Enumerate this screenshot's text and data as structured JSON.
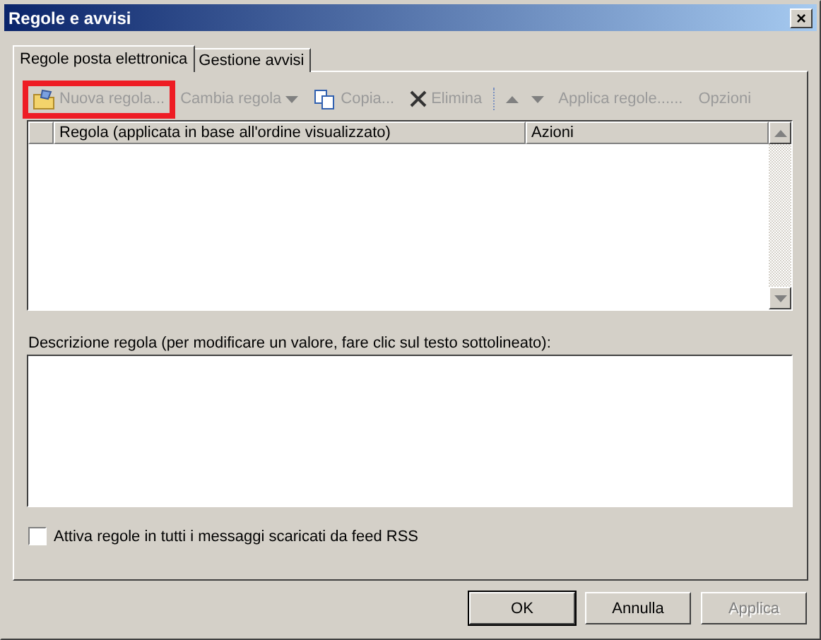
{
  "window": {
    "title": "Regole e avvisi",
    "close": "×"
  },
  "tabs": [
    {
      "label": "Regole posta elettronica",
      "selected": true
    },
    {
      "label": "Gestione avvisi",
      "selected": false
    }
  ],
  "toolbar": [
    {
      "kind": "new",
      "label": "Nuova regola...",
      "disabled": true,
      "highlighted": true
    },
    {
      "kind": "menu",
      "label": "Cambia regola",
      "disabled": true,
      "highlighted": false
    },
    {
      "kind": "copy",
      "label": "Copia...",
      "disabled": true,
      "highlighted": false
    },
    {
      "kind": "delete",
      "label": "Elimina",
      "disabled": true,
      "highlighted": false
    },
    {
      "kind": "separator"
    },
    {
      "kind": "up",
      "disabled": true
    },
    {
      "kind": "down",
      "disabled": true
    },
    {
      "kind": "button",
      "label": "Applica regole......",
      "disabled": true,
      "highlighted": false
    },
    {
      "kind": "button",
      "label": "Opzioni",
      "disabled": true,
      "highlighted": false
    }
  ],
  "rules_table": {
    "columns": [
      "Regola (applicata in base all'ordine visualizzato)",
      "Azioni"
    ]
  },
  "description": {
    "label": "Descrizione regola (per modificare un valore, fare clic sul testo sottolineato):"
  },
  "rss_option": {
    "label": "Attiva regole in tutti i messaggi scaricati da feed RSS",
    "checked": false
  },
  "buttons": [
    {
      "label": "OK",
      "disabled": false,
      "default": true
    },
    {
      "label": "Annulla",
      "disabled": false,
      "default": false
    },
    {
      "label": "Applica",
      "disabled": true,
      "default": false
    }
  ]
}
